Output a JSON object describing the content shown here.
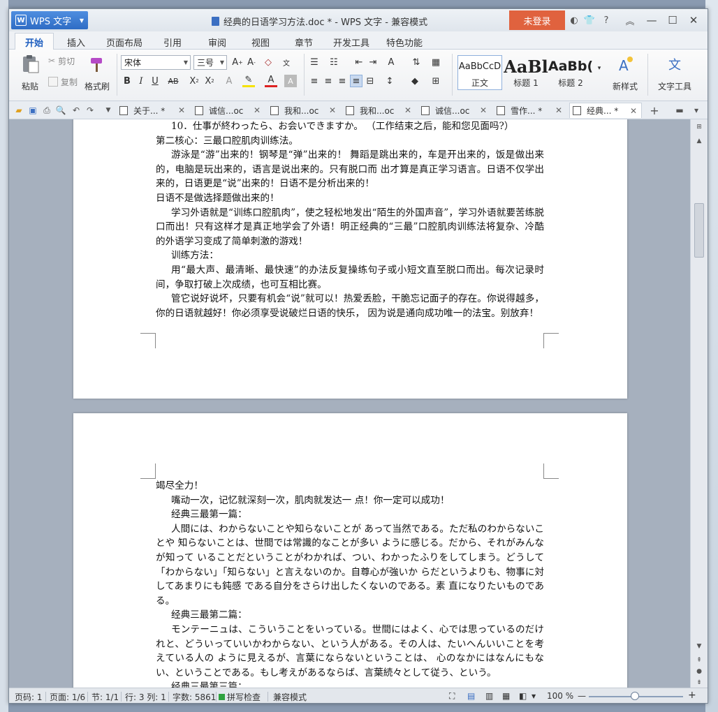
{
  "app": {
    "name": "WPS 文字",
    "window_title": "经典的日语学习方法.doc * - WPS 文字 - 兼容模式",
    "login_label": "未登录"
  },
  "ribbon_tabs": [
    "开始",
    "插入",
    "页面布局",
    "引用",
    "审阅",
    "视图",
    "章节",
    "开发工具",
    "特色功能"
  ],
  "ribbon": {
    "paste": "粘贴",
    "cut": "剪切",
    "copy": "复制",
    "format_painter": "格式刷",
    "font_name": "宋体",
    "font_size": "三号",
    "styles": [
      {
        "preview": "AaBbCcD",
        "label": "正文"
      },
      {
        "preview": "AaBl",
        "label": "标题 1"
      },
      {
        "preview": "AaBb(",
        "label": "标题 2"
      }
    ],
    "new_style": "新样式",
    "text_tools": "文字工具"
  },
  "doc_tabs": [
    {
      "label": "关于... *"
    },
    {
      "label": "诚信...oc"
    },
    {
      "label": "我和...oc"
    },
    {
      "label": "我和...oc"
    },
    {
      "label": "诚信...oc"
    },
    {
      "label": "雪作... *"
    },
    {
      "label": "经典... *"
    }
  ],
  "page1_paragraphs": [
    {
      "indent": true,
      "text": "10．仕事が終わったら、お会いできますか。 （工作结束之后，能和您见面吗?）"
    },
    {
      "indent": false,
      "text": "第二核心：三最口腔肌肉训练法。"
    },
    {
      "indent": true,
      "text": "游泳是“游”出来的！钢琴是“弹”出来的！ 舞蹈是跳出来的，车是开出来的，饭是做出来的，电脑是玩出来的，语言是说出来的。只有脱口而 出才算是真正学习语言。日语不仅学出来的，日语更是“说”出来的！日语不是分析出来的！"
    },
    {
      "indent": false,
      "text": "日语不是做选择题做出来的！"
    },
    {
      "indent": true,
      "text": "学习外语就是“训练口腔肌肉”，使之轻松地发出“陌生的外国声音”，学习外语就要苦练脱口而出！只有这样才是真正地学会了外语！明正经典的“三最”口腔肌肉训练法将复杂、冷酷的外语学习变成了简单刺激的游戏！"
    },
    {
      "indent": true,
      "text": "训练方法："
    },
    {
      "indent": true,
      "text": "用“最大声、最清晰、最快速”的办法反复操练句子或小短文直至脱口而出。每次记录时间，争取打破上次成绩，也可互相比赛。"
    },
    {
      "indent": true,
      "text": "管它说好说坏，只要有机会“说”就可以！热爱丢脸，干脆忘记面子的存在。你说得越多，你的日语就越好！你必须享受说破烂日语的快乐， 因为说是通向成功唯一的法宝。别放弃！"
    }
  ],
  "page2_paragraphs": [
    {
      "indent": false,
      "text": "竭尽全力！"
    },
    {
      "indent": true,
      "text": "嘴动一次，记忆就深刻一次，肌肉就发达一 点！你一定可以成功！"
    },
    {
      "indent": true,
      "text": "经典三最第一篇："
    },
    {
      "indent": true,
      "text": "人間には、わからないことや知らないことが あって当然である。ただ私のわからないことや 知らないことは、世間では常識的なことが多い ように感じる。だから、それがみんなが知って いることだということがわかれば、つい、わかったふりをしてしまう。どうして「わからない」「知らない」と言えないのか。自尊心が強いか らだというよりも、物事に対してあまりにも鈍感 である自分をさらけ出したくないのである。素 直になりたいものである。"
    },
    {
      "indent": true,
      "text": "经典三最第二篇："
    },
    {
      "indent": true,
      "text": "モンテーニュは、こういうことをいっている。世間にはよく、心では思っているのだけれと、どういっていいかわからない、という人がある。その人は、たいへんいいことを考えている人の ように見えるが、言葉にならないということは、 心のなかにはなんにもない、ということである。もし考えがあるならば、言葉続々として従う、という。"
    },
    {
      "indent": true,
      "text": "经典三最第三篇："
    }
  ],
  "status": {
    "page_num": "页码: 1",
    "pages": "页面: 1/6",
    "section": "节: 1/1",
    "row_col": "行: 3  列: 1",
    "word_count": "字数: 5861",
    "spell_check": "拼写检查",
    "compat_mode": "兼容模式",
    "zoom": "100 %"
  }
}
